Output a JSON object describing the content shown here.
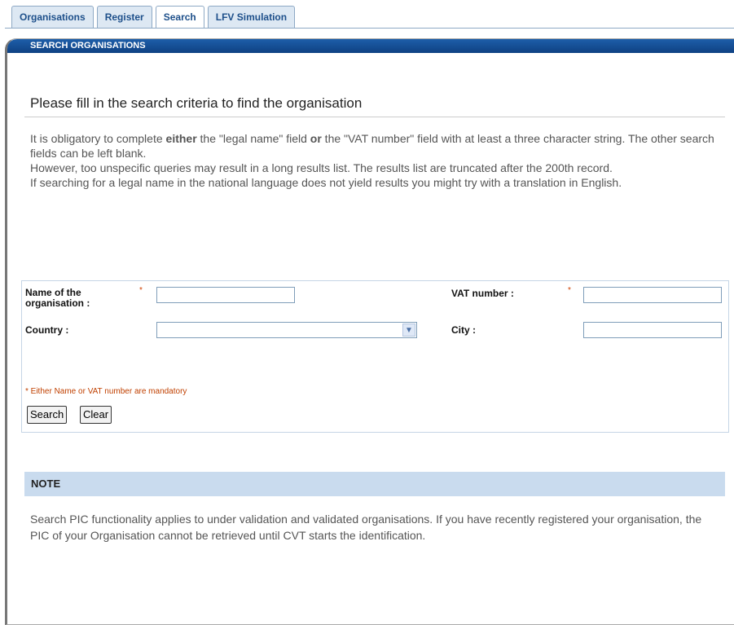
{
  "tabs": [
    {
      "label": "Organisations",
      "active": false
    },
    {
      "label": "Register",
      "active": false
    },
    {
      "label": "Search",
      "active": true
    },
    {
      "label": "LFV Simulation",
      "active": false
    }
  ],
  "panel": {
    "header": "SEARCH ORGANISATIONS"
  },
  "heading": "Please fill in the search criteria to find the organisation",
  "intro": {
    "p1_a": "It is obligatory to complete ",
    "p1_b": "either",
    "p1_c": " the \"legal name\" field ",
    "p1_d": "or",
    "p1_e": " the \"VAT number\" field with at least a three character string. The other search fields can be left blank.",
    "p2": "However, too unspecific queries may result in a long results list. The results list are truncated after the 200th record.",
    "p3": "If searching for a legal name in the national language does not yield results you might try with a translation in English."
  },
  "form": {
    "name_label": "Name of the organisation :",
    "vat_label": "VAT number :",
    "country_label": "Country :",
    "city_label": "City :",
    "required_mark": "*",
    "name_value": "",
    "vat_value": "",
    "country_value": "",
    "city_value": "",
    "mandatory_note": "* Either Name or VAT number are mandatory",
    "search_label": "Search",
    "clear_label": "Clear"
  },
  "note": {
    "title": "NOTE",
    "text": "Search PIC functionality applies to under validation and validated organisations. If you have recently registered your organisation, the PIC of your Organisation cannot be retrieved until CVT starts the identification."
  },
  "icons": {
    "dropdown": "chevron-down-icon"
  },
  "colors": {
    "header_blue": "#0f4182",
    "tab_bg": "#dde8f3",
    "note_bg": "#c9dbee",
    "required": "#d04000"
  }
}
